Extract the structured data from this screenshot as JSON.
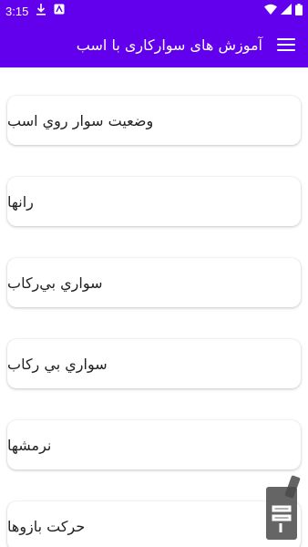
{
  "status_bar": {
    "time": "3:15",
    "icons": [
      "download-icon",
      "app-notification-icon",
      "wifi-icon",
      "signal-icon",
      "battery-icon"
    ],
    "background": "#6200ee"
  },
  "app_bar": {
    "title": "آموزش های سوارکاری با اسب",
    "menu_icon": "hamburger-menu-icon",
    "background": "#6200ee"
  },
  "items": [
    {
      "label": "وضعيت سوار روي اسب"
    },
    {
      "label": "رانها"
    },
    {
      "label": "سواري بي‌ركاب"
    },
    {
      "label": "سواري بي ركاب"
    },
    {
      "label": "نرمشها"
    },
    {
      "label": "حركت بازوها"
    }
  ],
  "watermark": {
    "icon": "store-logo-icon"
  }
}
